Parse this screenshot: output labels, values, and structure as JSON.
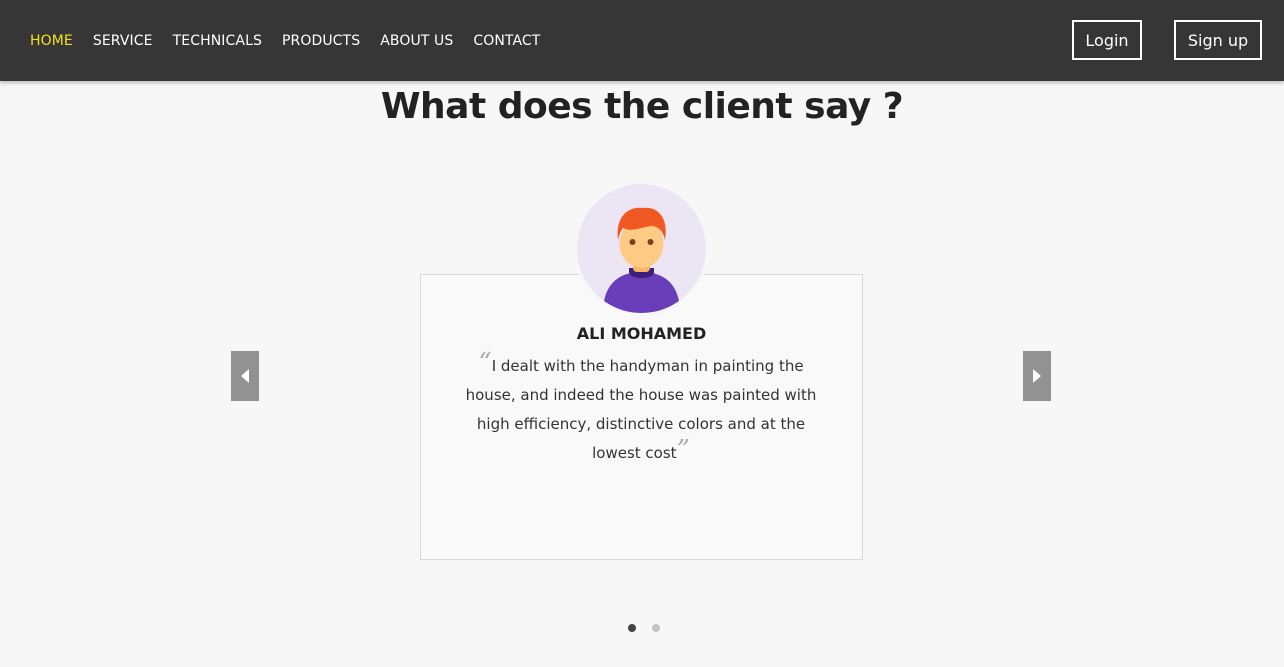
{
  "nav": {
    "links": [
      "HOME",
      "SERVICE",
      "TECHNICALS",
      "PRODUCTS",
      "ABOUT US",
      "CONTACT"
    ],
    "active_index": 0,
    "login_label": "Login",
    "signup_label": "Sign up"
  },
  "testimonials": {
    "title": "What does the client say ?",
    "current": {
      "name": "ALI MOHAMED",
      "quote": "I dealt with the handyman in painting the house, and indeed the house was painted with high efficiency, distinctive colors and at the lowest cost",
      "open_quote": "“",
      "close_quote": "”"
    },
    "slide_count": 2,
    "active_slide": 1
  },
  "colors": {
    "navbar_bg": "#363636",
    "active_link": "#f3e21b",
    "arrow_bg": "#929292",
    "dot_active": "#444444",
    "dot_inactive": "#c4c4c4"
  }
}
